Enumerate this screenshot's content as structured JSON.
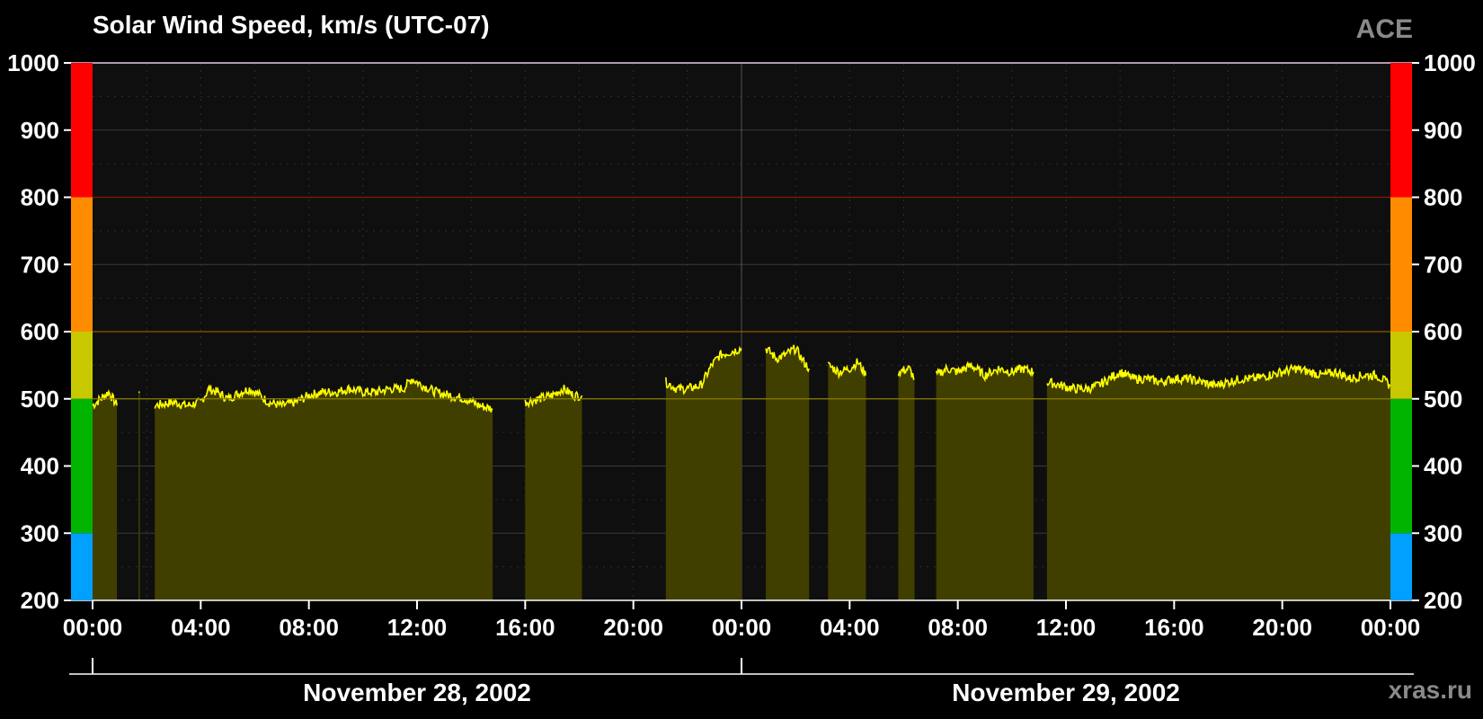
{
  "header": {
    "title": "Solar Wind Speed, km/s (UTC-07)",
    "source": "ACE"
  },
  "footer": {
    "watermark": "xras.ru"
  },
  "colors": {
    "background": "#000000",
    "plot_background": "#0f0f0f",
    "line": "#ffff00",
    "fill": "#403f00",
    "grid": "#3a3a3a",
    "band_blue": "#00a0ff",
    "band_green": "#00b400",
    "band_yellow": "#c8c800",
    "band_orange": "#ff8c00",
    "band_red": "#ff0000"
  },
  "chart_data": {
    "type": "area",
    "title": "Solar Wind Speed, km/s (UTC-07)",
    "xlabel": "",
    "ylabel": "",
    "ylim": [
      200,
      1000
    ],
    "xlim_hours": [
      0,
      48
    ],
    "y_ticks": [
      200,
      300,
      400,
      500,
      600,
      700,
      800,
      900,
      1000
    ],
    "x_ticks": [
      {
        "hour": 0,
        "label": "00:00"
      },
      {
        "hour": 4,
        "label": "04:00"
      },
      {
        "hour": 8,
        "label": "08:00"
      },
      {
        "hour": 12,
        "label": "12:00"
      },
      {
        "hour": 16,
        "label": "16:00"
      },
      {
        "hour": 20,
        "label": "20:00"
      },
      {
        "hour": 24,
        "label": "00:00"
      },
      {
        "hour": 28,
        "label": "04:00"
      },
      {
        "hour": 32,
        "label": "08:00"
      },
      {
        "hour": 36,
        "label": "12:00"
      },
      {
        "hour": 40,
        "label": "16:00"
      },
      {
        "hour": 44,
        "label": "20:00"
      },
      {
        "hour": 48,
        "label": "00:00"
      }
    ],
    "date_labels": [
      {
        "center_hour": 12,
        "label": "November 28, 2002"
      },
      {
        "center_hour": 36,
        "label": "November 29, 2002"
      }
    ],
    "threshold_lines": [
      500,
      600,
      800
    ],
    "color_bands": [
      {
        "from": 200,
        "to": 300,
        "color": "#00a0ff"
      },
      {
        "from": 300,
        "to": 500,
        "color": "#00b400"
      },
      {
        "from": 500,
        "to": 600,
        "color": "#c8c800"
      },
      {
        "from": 600,
        "to": 800,
        "color": "#ff8c00"
      },
      {
        "from": 800,
        "to": 1000,
        "color": "#ff0000"
      }
    ],
    "grid": true,
    "series": [
      {
        "values_note": "x in hours since Nov 28 00:00 (UTC-07), y in km/s; null = data gap",
        "points": [
          [
            0.0,
            490
          ],
          [
            0.3,
            500
          ],
          [
            0.6,
            510
          ],
          [
            0.9,
            490
          ],
          [
            1.0,
            null
          ],
          [
            1.7,
            510
          ],
          [
            1.75,
            null
          ],
          [
            2.3,
            490
          ],
          [
            3.0,
            495
          ],
          [
            3.5,
            490
          ],
          [
            4.0,
            495
          ],
          [
            4.3,
            515
          ],
          [
            4.6,
            510
          ],
          [
            5.0,
            500
          ],
          [
            5.5,
            510
          ],
          [
            5.8,
            515
          ],
          [
            6.2,
            505
          ],
          [
            6.5,
            495
          ],
          [
            7.0,
            490
          ],
          [
            7.5,
            495
          ],
          [
            8.0,
            505
          ],
          [
            8.5,
            510
          ],
          [
            9.0,
            510
          ],
          [
            9.5,
            515
          ],
          [
            10.0,
            510
          ],
          [
            10.5,
            510
          ],
          [
            11.0,
            515
          ],
          [
            11.5,
            515
          ],
          [
            11.8,
            530
          ],
          [
            12.2,
            520
          ],
          [
            12.7,
            510
          ],
          [
            13.2,
            505
          ],
          [
            13.8,
            500
          ],
          [
            14.3,
            490
          ],
          [
            14.8,
            485
          ],
          [
            15.0,
            null
          ],
          [
            16.0,
            495
          ],
          [
            16.5,
            500
          ],
          [
            17.0,
            505
          ],
          [
            17.4,
            515
          ],
          [
            17.8,
            505
          ],
          [
            18.1,
            505
          ],
          [
            18.2,
            null
          ],
          [
            21.2,
            525
          ],
          [
            21.6,
            515
          ],
          [
            22.0,
            515
          ],
          [
            22.5,
            520
          ],
          [
            22.9,
            550
          ],
          [
            23.2,
            565
          ],
          [
            23.6,
            570
          ],
          [
            24.0,
            575
          ],
          [
            24.2,
            null
          ],
          [
            24.9,
            575
          ],
          [
            25.3,
            560
          ],
          [
            25.6,
            565
          ],
          [
            26.0,
            575
          ],
          [
            26.3,
            555
          ],
          [
            26.5,
            545
          ],
          [
            26.6,
            null
          ],
          [
            27.2,
            550
          ],
          [
            27.6,
            540
          ],
          [
            28.0,
            545
          ],
          [
            28.3,
            555
          ],
          [
            28.6,
            535
          ],
          [
            28.7,
            null
          ],
          [
            29.8,
            540
          ],
          [
            30.2,
            545
          ],
          [
            30.4,
            530
          ],
          [
            30.5,
            null
          ],
          [
            31.2,
            535
          ],
          [
            31.6,
            545
          ],
          [
            32.0,
            540
          ],
          [
            32.5,
            550
          ],
          [
            33.0,
            535
          ],
          [
            33.5,
            545
          ],
          [
            34.0,
            540
          ],
          [
            34.4,
            545
          ],
          [
            34.8,
            540
          ],
          [
            35.0,
            null
          ],
          [
            35.3,
            525
          ],
          [
            35.8,
            520
          ],
          [
            36.3,
            515
          ],
          [
            36.8,
            515
          ],
          [
            37.2,
            520
          ],
          [
            37.6,
            530
          ],
          [
            38.0,
            540
          ],
          [
            38.5,
            530
          ],
          [
            39.0,
            530
          ],
          [
            39.5,
            525
          ],
          [
            40.0,
            530
          ],
          [
            40.5,
            530
          ],
          [
            41.0,
            525
          ],
          [
            41.5,
            520
          ],
          [
            42.0,
            525
          ],
          [
            42.5,
            530
          ],
          [
            43.0,
            530
          ],
          [
            43.5,
            535
          ],
          [
            44.0,
            540
          ],
          [
            44.5,
            545
          ],
          [
            45.0,
            540
          ],
          [
            45.5,
            535
          ],
          [
            46.0,
            540
          ],
          [
            46.5,
            530
          ],
          [
            47.0,
            535
          ],
          [
            47.5,
            535
          ],
          [
            48.0,
            520
          ]
        ]
      }
    ]
  }
}
